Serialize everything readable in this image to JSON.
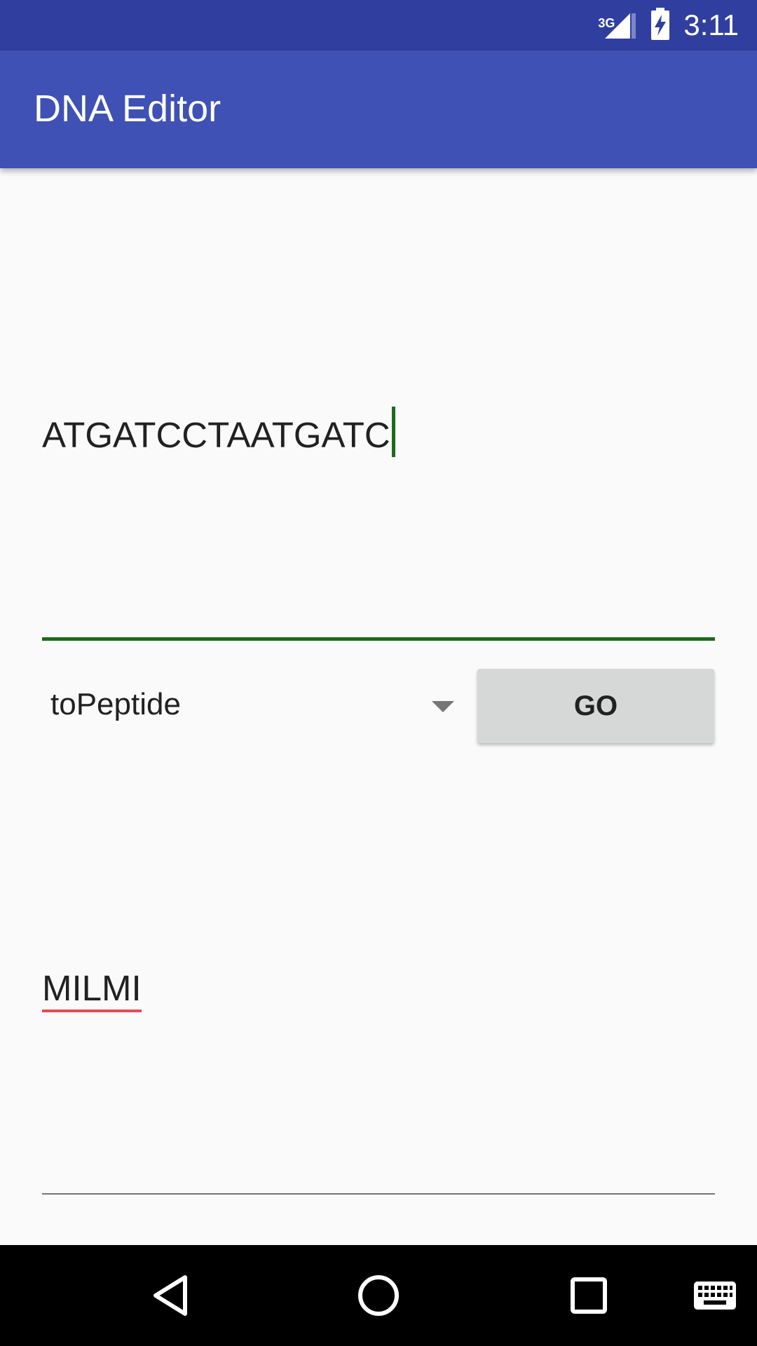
{
  "status_bar": {
    "network": "3G",
    "time": "3:11",
    "icons": [
      "signal-icon",
      "battery-charging-icon"
    ]
  },
  "app_bar": {
    "title": "DNA Editor"
  },
  "dna_input": {
    "value": "ATGATCCTAATGATC"
  },
  "spinner": {
    "selected": "toPeptide"
  },
  "go_button": {
    "label": "GO"
  },
  "result": {
    "value": "MILMI"
  },
  "nav_bar": {
    "icons": [
      "back-icon",
      "home-icon",
      "recents-icon",
      "keyboard-icon"
    ]
  },
  "colors": {
    "status_bar": "#303f9f",
    "app_bar": "#3f51b5",
    "input_accent": "#1b6b1b",
    "button_bg": "#d6d7d7",
    "spellcheck_underline": "#e84b55"
  }
}
